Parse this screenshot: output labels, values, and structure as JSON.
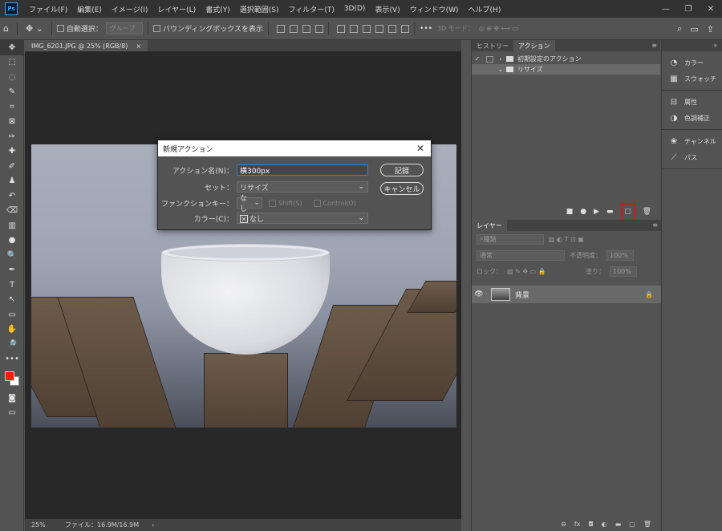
{
  "app": {
    "logo": "Ps"
  },
  "menu": [
    "ファイル(F)",
    "編集(E)",
    "イメージ(I)",
    "レイヤー(L)",
    "書式(Y)",
    "選択範囲(S)",
    "フィルター(T)",
    "3D(D)",
    "表示(V)",
    "ウィンドウ(W)",
    "ヘルプ(H)"
  ],
  "window_controls": {
    "minimize": "—",
    "restore": "❐",
    "close": "✕"
  },
  "options": {
    "auto_select": "自動選択：",
    "group": "グループ",
    "bounding_box": "バウンディングボックスを表示",
    "more": "•••",
    "mode3d": "3D モード："
  },
  "tools": [
    "✥",
    "⬚",
    "◌",
    "✎",
    "⌗",
    "⊠",
    "✑",
    "✚",
    "✐",
    "♟",
    "↶",
    "⌫",
    "▥",
    "●",
    "🔍",
    "✒",
    "T",
    "↖",
    "▭",
    "✋",
    "🔎",
    "•••"
  ],
  "document": {
    "tab_title": "IMG_6201.JPG @ 25% (RGB/8)",
    "tab_close": "×",
    "zoom": "25%",
    "file_info": "ファイル：16.9M/16.9M",
    "status_arrow": "›"
  },
  "dialog": {
    "title": "新規アクション",
    "close": "✕",
    "name_label": "アクション名(N)：",
    "name_value": "横300px",
    "set_label": "セット：",
    "set_value": "リサイズ",
    "fkey_label": "ファンクションキー：",
    "fkey_value": "なし",
    "shift_label": "Shift(S)",
    "control_label": "Control(O)",
    "color_label": "カラー(C)：",
    "color_value": "なし",
    "record_button": "記録",
    "cancel_button": "キャンセル"
  },
  "actions_panel": {
    "tabs": [
      "ヒストリー",
      "アクション"
    ],
    "menu": "≡",
    "rows": [
      {
        "check": "✓",
        "arrow": "›",
        "label": "初期設定のアクション"
      },
      {
        "check": "",
        "arrow": "⌄",
        "label": "リサイズ"
      }
    ],
    "footer_icons": [
      "■",
      "●",
      "▶",
      "▬",
      "▢",
      "🗑"
    ]
  },
  "layers_panel": {
    "tab": "レイヤー",
    "menu": "≡",
    "kind_placeholder": "種類",
    "blend_mode": "通常",
    "opacity_label": "不透明度：",
    "opacity_value": "100%",
    "lock_label": "ロック：",
    "fill_label": "塗り：",
    "fill_value": "100%",
    "layer_name": "背景",
    "footer_icons": [
      "⊖",
      "fx",
      "◘",
      "◐",
      "▬",
      "▢",
      "🗑"
    ]
  },
  "dock": [
    {
      "icon": "◔",
      "label": "カラー"
    },
    {
      "icon": "▦",
      "label": "スウォッチ"
    },
    {
      "icon": "⊟",
      "label": "属性"
    },
    {
      "icon": "◑",
      "label": "色調補正"
    },
    {
      "icon": "❀",
      "label": "チャンネル"
    },
    {
      "icon": "⟋",
      "label": "パス"
    }
  ],
  "colors": {
    "foreground": "#ff1a00",
    "background": "#ffffff",
    "highlight": "#e0140f"
  }
}
